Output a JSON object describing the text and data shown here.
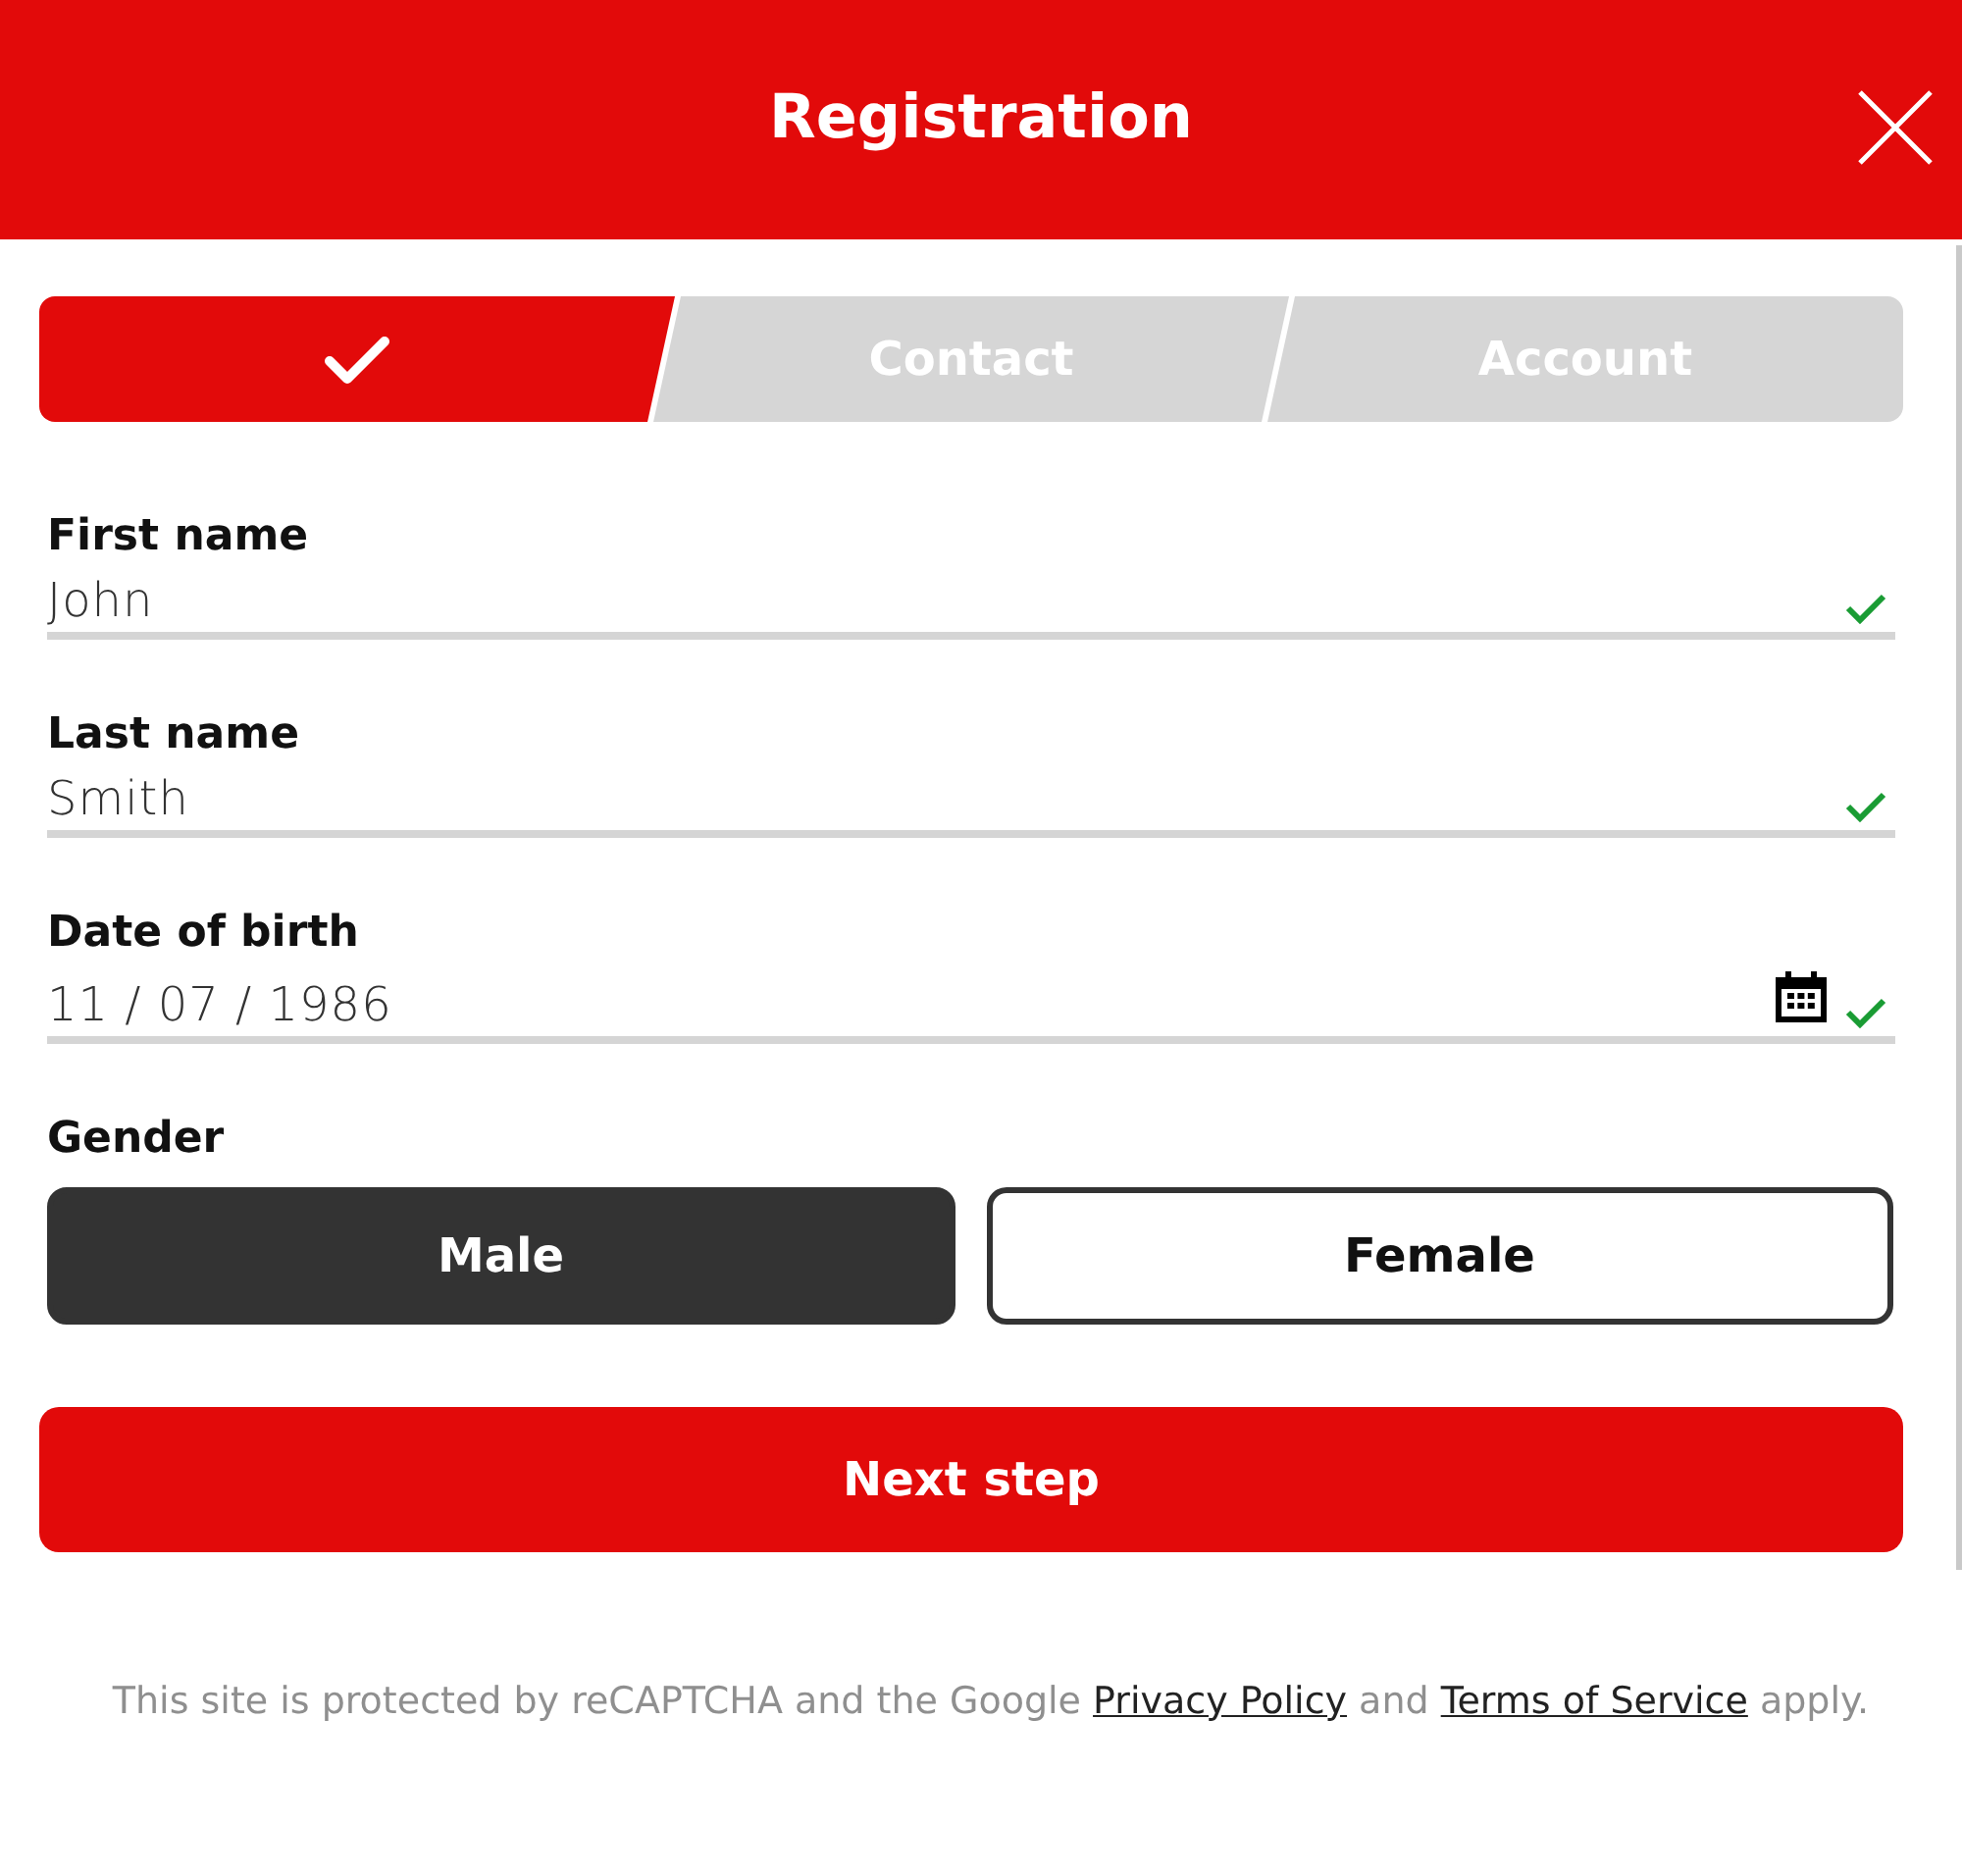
{
  "header": {
    "title": "Registration"
  },
  "steps": [
    {
      "done": true
    },
    {
      "label": "Contact",
      "done": false
    },
    {
      "label": "Account",
      "done": false
    }
  ],
  "fields": [
    {
      "kind": "text",
      "label": "First name",
      "value": "John",
      "valid": true
    },
    {
      "kind": "text",
      "label": "Last name",
      "value": "Smith",
      "valid": true
    },
    {
      "kind": "date",
      "label": "Date of birth",
      "value": "11 / 07 / 1986",
      "valid": true
    }
  ],
  "gender": {
    "label": "Gender",
    "options": [
      {
        "label": "Male",
        "selected": true
      },
      {
        "label": "Female",
        "selected": false
      }
    ]
  },
  "next_button": "Next step",
  "footer": [
    {
      "kind": "plain",
      "text": "This site is protected by reCAPTCHA and the Google "
    },
    {
      "kind": "link",
      "text": "Privacy Policy"
    },
    {
      "kind": "plain",
      "text": " and "
    },
    {
      "kind": "link",
      "text": "Terms of Service"
    },
    {
      "kind": "plain",
      "text": " apply."
    }
  ]
}
